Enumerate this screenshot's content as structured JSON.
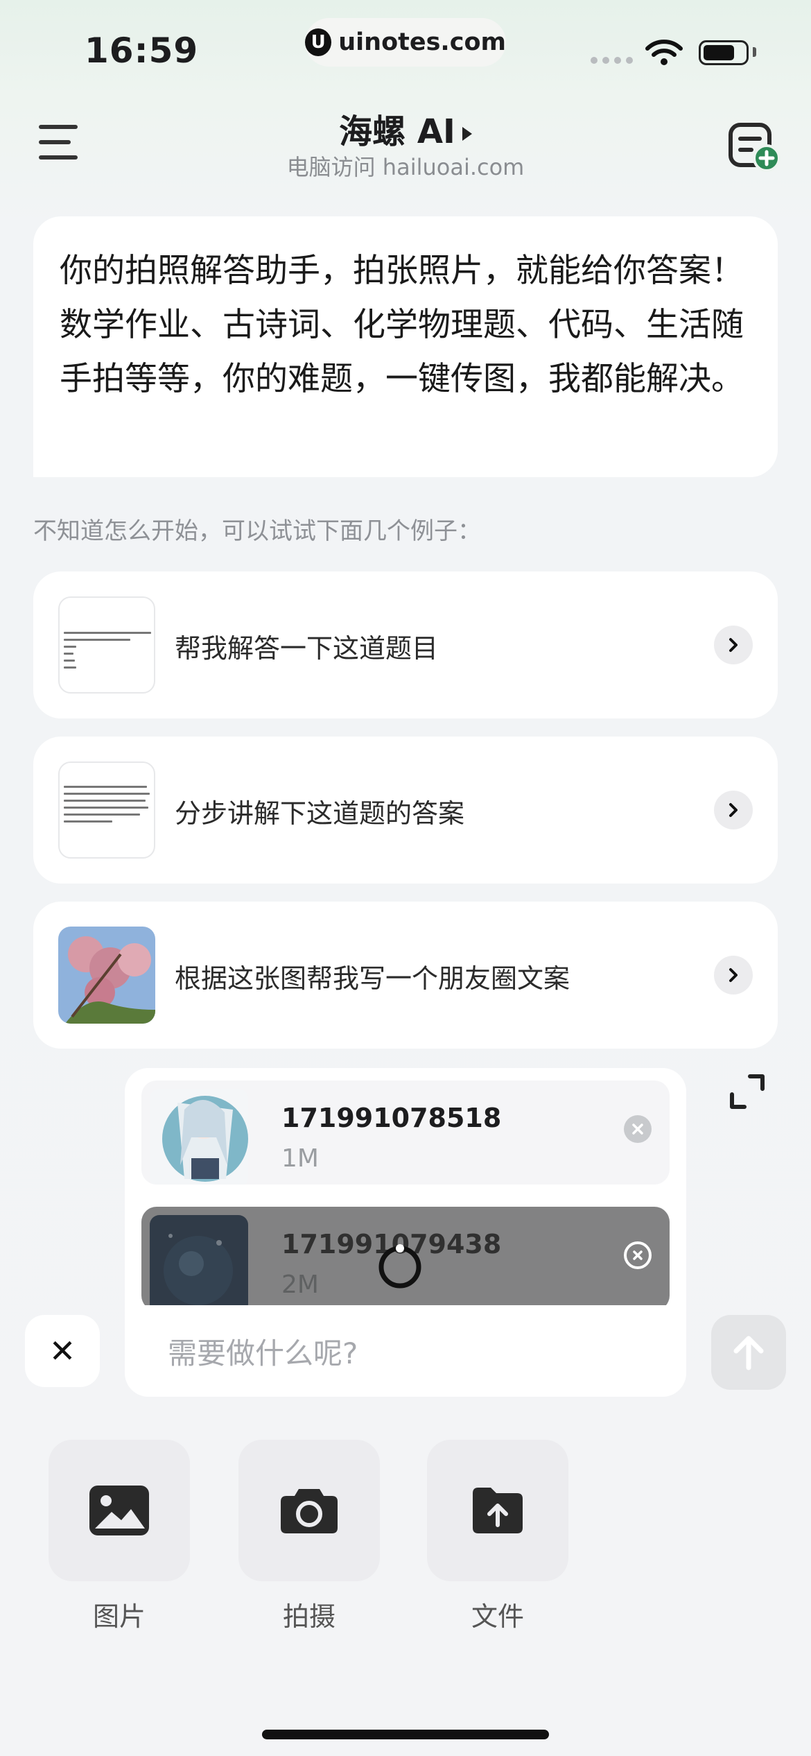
{
  "status_bar": {
    "time": "16:59",
    "url": "uinotes.com",
    "url_logo": "U"
  },
  "header": {
    "title": "海螺 AI",
    "subtitle": "电脑访问 hailuoai.com"
  },
  "intro_message": "你的拍照解答助手，拍张照片，就能给你答案！数学作业、古诗词、化学物理题、代码、生活随手拍等等，你的难题，一键传图，我都能解决。",
  "examples": {
    "hint": "不知道怎么开始，可以试试下面几个例子：",
    "items": [
      {
        "label": "帮我解答一下这道题目"
      },
      {
        "label": "分步讲解下这道题的答案"
      },
      {
        "label": "根据这张图帮我写一个朋友圈文案"
      }
    ]
  },
  "attachments": [
    {
      "name": "171991078518",
      "size": "1M",
      "state": "uploaded"
    },
    {
      "name": "171991079438",
      "size": "2M",
      "state": "uploading"
    }
  ],
  "input": {
    "placeholder": "需要做什么呢?"
  },
  "close_glyph": "✕",
  "tools": [
    {
      "label": "图片",
      "icon": "image-icon"
    },
    {
      "label": "拍摄",
      "icon": "camera-icon"
    },
    {
      "label": "文件",
      "icon": "file-upload-icon"
    }
  ],
  "colors": {
    "background": "#f3f4f6",
    "card": "#ffffff",
    "uploading_overlay": "#7a7a7a",
    "tool_bg": "#ececef",
    "accent_green": "#2e8b57"
  }
}
